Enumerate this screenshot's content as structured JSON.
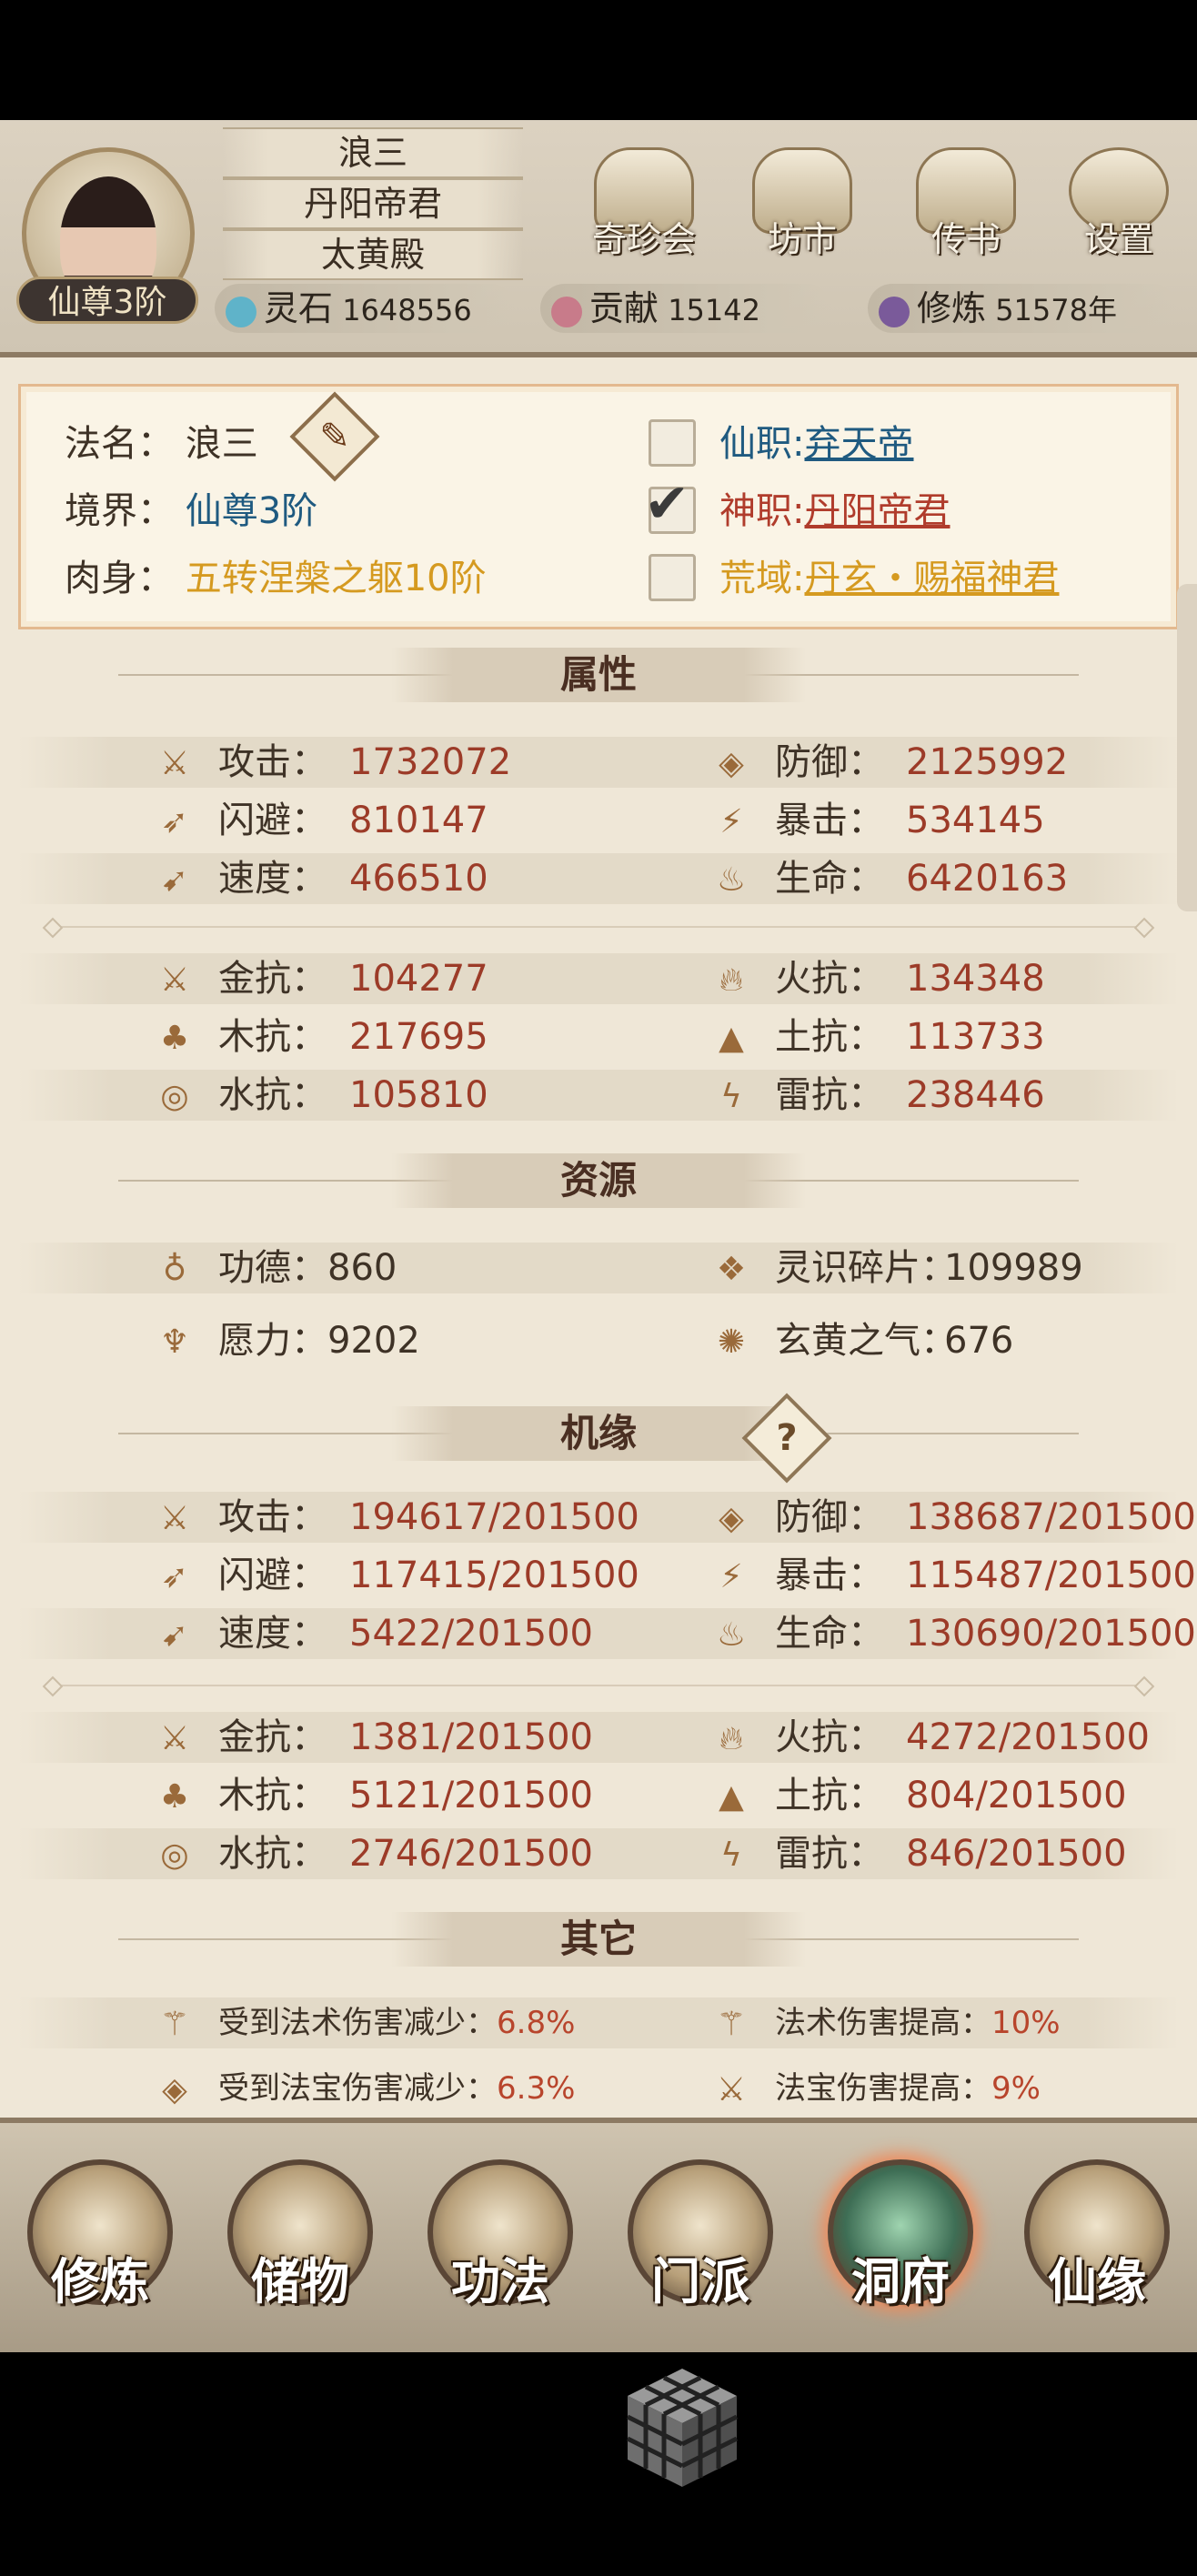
{
  "header": {
    "player_name": "浪三",
    "title": "丹阳帝君",
    "sect": "太黄殿",
    "rank_badge": "仙尊3阶",
    "buttons": [
      "奇珍会",
      "坊市",
      "传书",
      "设置"
    ],
    "resources": [
      {
        "label": "灵石",
        "value": "1648556"
      },
      {
        "label": "贡献",
        "value": "15142"
      },
      {
        "label": "修炼",
        "value": "51578年"
      }
    ]
  },
  "info": {
    "dharma_name_label": "法名：",
    "dharma_name": "浪三",
    "realm_label": "境界：",
    "realm": "仙尊3阶",
    "body_label": "肉身：",
    "body": "五转涅槃之躯10阶",
    "immortal_post_label": "仙职:",
    "immortal_post": "弃天帝",
    "divine_post_label": "神职:",
    "divine_post": "丹阳帝君",
    "wild_domain_label": "荒域:",
    "wild_domain": "丹玄・赐福神君"
  },
  "attributes": {
    "title": "属性",
    "rows": [
      [
        {
          "label": "攻击：",
          "value": "1732072"
        },
        {
          "label": "防御：",
          "value": "2125992"
        }
      ],
      [
        {
          "label": "闪避：",
          "value": "810147"
        },
        {
          "label": "暴击：",
          "value": "534145"
        }
      ],
      [
        {
          "label": "速度：",
          "value": "466510"
        },
        {
          "label": "生命：",
          "value": "6420163"
        }
      ],
      [
        {
          "label": "金抗：",
          "value": "104277"
        },
        {
          "label": "火抗：",
          "value": "134348"
        }
      ],
      [
        {
          "label": "木抗：",
          "value": "217695"
        },
        {
          "label": "土抗：",
          "value": "113733"
        }
      ],
      [
        {
          "label": "水抗：",
          "value": "105810"
        },
        {
          "label": "雷抗：",
          "value": "238446"
        }
      ]
    ]
  },
  "resources": {
    "title": "资源",
    "rows": [
      [
        {
          "label": "功德：",
          "value": "860"
        },
        {
          "label": "灵识碎片：",
          "value": "109989"
        }
      ],
      [
        {
          "label": "愿力：",
          "value": "9202"
        },
        {
          "label": "玄黄之气：",
          "value": "676"
        }
      ]
    ]
  },
  "fortune": {
    "title": "机缘",
    "rows": [
      [
        {
          "label": "攻击：",
          "value": "194617/201500"
        },
        {
          "label": "防御：",
          "value": "138687/201500"
        }
      ],
      [
        {
          "label": "闪避：",
          "value": "117415/201500"
        },
        {
          "label": "暴击：",
          "value": "115487/201500"
        }
      ],
      [
        {
          "label": "速度：",
          "value": "5422/201500"
        },
        {
          "label": "生命：",
          "value": "130690/201500"
        }
      ],
      [
        {
          "label": "金抗：",
          "value": "1381/201500"
        },
        {
          "label": "火抗：",
          "value": "4272/201500"
        }
      ],
      [
        {
          "label": "木抗：",
          "value": "5121/201500"
        },
        {
          "label": "土抗：",
          "value": "804/201500"
        }
      ],
      [
        {
          "label": "水抗：",
          "value": "2746/201500"
        },
        {
          "label": "雷抗：",
          "value": "846/201500"
        }
      ]
    ]
  },
  "other": {
    "title": "其它",
    "rows": [
      [
        {
          "label": "受到法术伤害减少：",
          "value": "6.8%"
        },
        {
          "label": "法术伤害提高：",
          "value": "10%"
        }
      ],
      [
        {
          "label": "受到法宝伤害减少：",
          "value": "6.3%"
        },
        {
          "label": "法宝伤害提高：",
          "value": "9%"
        }
      ]
    ]
  },
  "bottom_nav": {
    "items": [
      "修炼",
      "储物",
      "功法",
      "门派",
      "洞府",
      "仙缘"
    ],
    "active": "洞府"
  }
}
